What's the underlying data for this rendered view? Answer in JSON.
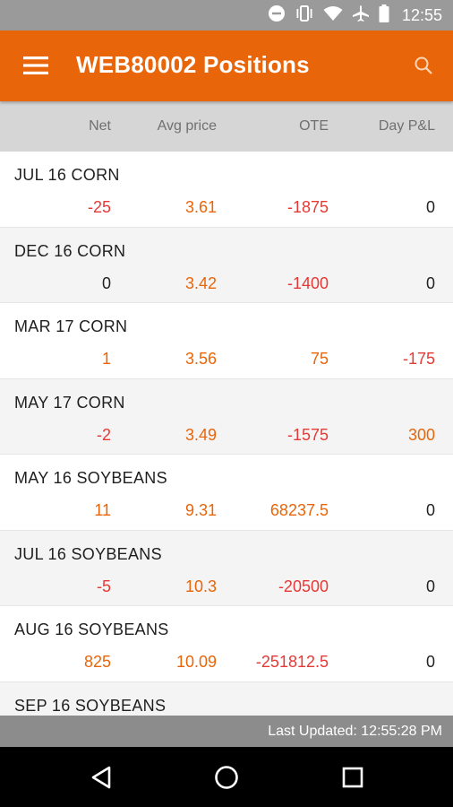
{
  "status_bar": {
    "time": "12:55"
  },
  "app_bar": {
    "title": "WEB80002 Positions"
  },
  "columns": {
    "net": "Net",
    "avg_price": "Avg price",
    "ote": "OTE",
    "day_pnl": "Day P&L"
  },
  "colors": {
    "accent": "#e8650a",
    "negative": "#e53935",
    "neutral": "#222222"
  },
  "positions": [
    {
      "name": "JUL 16 CORN",
      "net": "-25",
      "avg_price": "3.61",
      "ote": "-1875",
      "day_pnl": "0"
    },
    {
      "name": "DEC 16 CORN",
      "net": "0",
      "avg_price": "3.42",
      "ote": "-1400",
      "day_pnl": "0"
    },
    {
      "name": "MAR 17 CORN",
      "net": "1",
      "avg_price": "3.56",
      "ote": "75",
      "day_pnl": "-175"
    },
    {
      "name": "MAY 17 CORN",
      "net": "-2",
      "avg_price": "3.49",
      "ote": "-1575",
      "day_pnl": "300"
    },
    {
      "name": "MAY 16 SOYBEANS",
      "net": "11",
      "avg_price": "9.31",
      "ote": "68237.5",
      "day_pnl": "0"
    },
    {
      "name": "JUL 16 SOYBEANS",
      "net": "-5",
      "avg_price": "10.3",
      "ote": "-20500",
      "day_pnl": "0"
    },
    {
      "name": "AUG 16 SOYBEANS",
      "net": "825",
      "avg_price": "10.09",
      "ote": "-251812.5",
      "day_pnl": "0"
    },
    {
      "name": "SEP 16 SOYBEANS",
      "net": "",
      "avg_price": "",
      "ote": "",
      "day_pnl": ""
    }
  ],
  "footer": {
    "last_updated": "Last Updated: 12:55:28 PM"
  },
  "nav": {
    "back": "back-icon",
    "home": "home-icon",
    "recents": "recents-icon"
  }
}
